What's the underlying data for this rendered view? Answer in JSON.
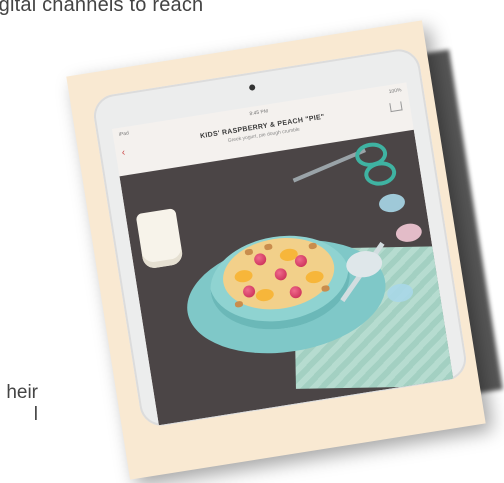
{
  "page": {
    "top_text": "igital channels to reach",
    "left_text_line1": "heir",
    "left_text_line2": "l"
  },
  "tablet": {
    "status_left": "iPad",
    "status_center": "8:45 PM",
    "status_right": "100%",
    "recipe_title": "KIDS' RASPBERRY & PEACH \"PIE\"",
    "recipe_subtitle": "Greek yogurt, pie dough crumble"
  },
  "colors": {
    "card": "#f9e9d2",
    "bowl": "#8fd3d1",
    "berry": "#c3234d",
    "peach": "#f7b63a",
    "scissors": "#3fb3a2"
  }
}
